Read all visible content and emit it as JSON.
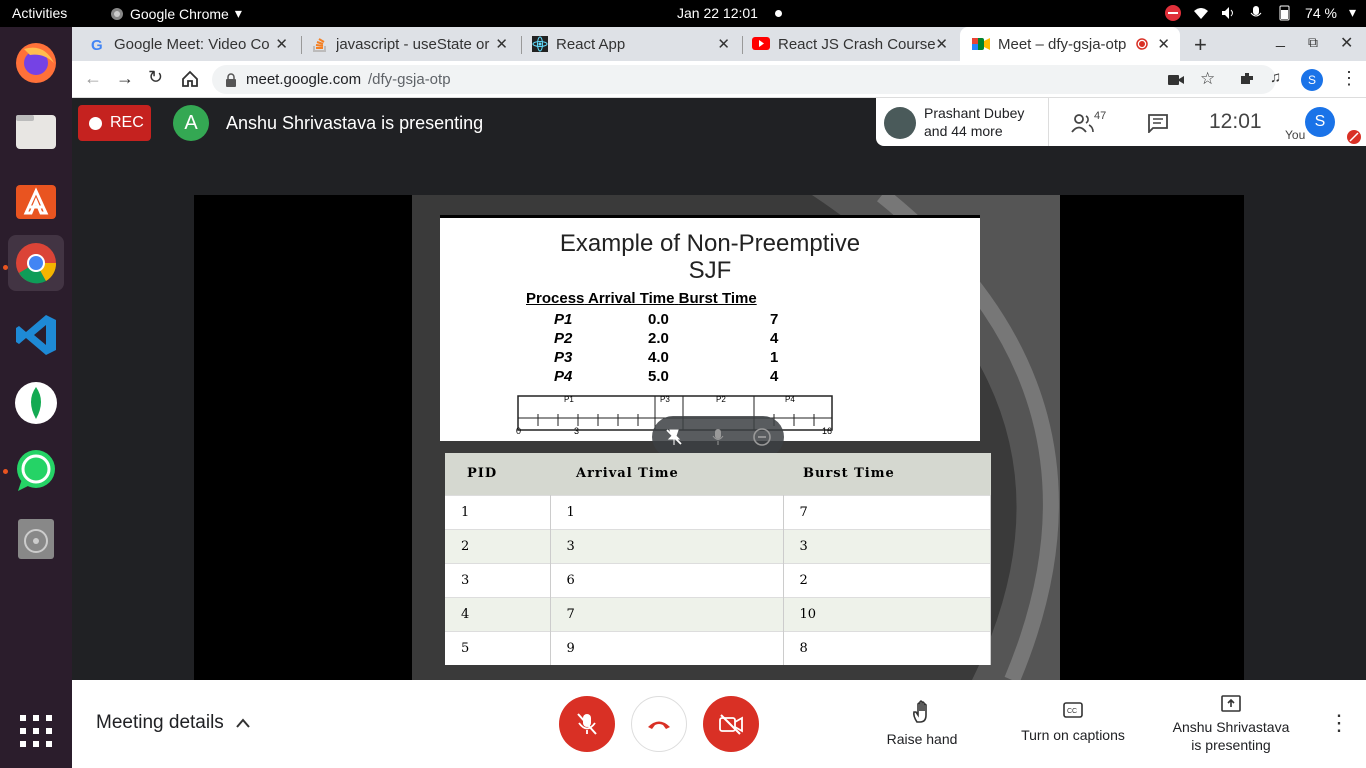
{
  "system": {
    "activities": "Activities",
    "app_name": "Google Chrome",
    "clock": "Jan 22  12:01",
    "battery": "74 %"
  },
  "tabs": [
    {
      "label": "Google Meet: Video Co"
    },
    {
      "label": "javascript - useState or"
    },
    {
      "label": "React App"
    },
    {
      "label": "React JS Crash Course"
    },
    {
      "label": "Meet – dfy-gsja-otp"
    }
  ],
  "address_bar": {
    "url_host": "meet.google.com",
    "url_path": "/dfy-gsja-otp"
  },
  "profile_initial": "S",
  "meet": {
    "rec_label": "REC",
    "presenter_initial": "A",
    "presenter_text": "Anshu Shrivastava is presenting",
    "participant_name": "Prashant Dubey",
    "participant_more": "and 44 more",
    "participant_count": "47",
    "time": "12:01",
    "you_label": "You",
    "you_initial": "S"
  },
  "slide": {
    "title_line1": "Example of Non-Preemptive",
    "title_line2": "SJF",
    "header": [
      "Process",
      "Arrival Time",
      "Burst Time"
    ],
    "rows": [
      [
        "P1",
        "0.0",
        "7"
      ],
      [
        "P2",
        "2.0",
        "4"
      ],
      [
        "P3",
        "4.0",
        "1"
      ],
      [
        "P4",
        "5.0",
        "4"
      ]
    ],
    "gantt_labels": [
      "P1",
      "P3",
      "P2",
      "P4"
    ],
    "axis_labels": [
      "0",
      "3",
      "16"
    ]
  },
  "table": {
    "headers": [
      "PID",
      "Arrival Time",
      "Burst Time"
    ],
    "rows": [
      [
        "1",
        "1",
        "7"
      ],
      [
        "2",
        "3",
        "3"
      ],
      [
        "3",
        "6",
        "2"
      ],
      [
        "4",
        "7",
        "10"
      ],
      [
        "5",
        "9",
        "8"
      ]
    ]
  },
  "bottom": {
    "meeting_details": "Meeting details",
    "raise_hand": "Raise hand",
    "captions": "Turn on captions",
    "presenting_line1": "Anshu Shrivastava",
    "presenting_line2": "is presenting"
  }
}
